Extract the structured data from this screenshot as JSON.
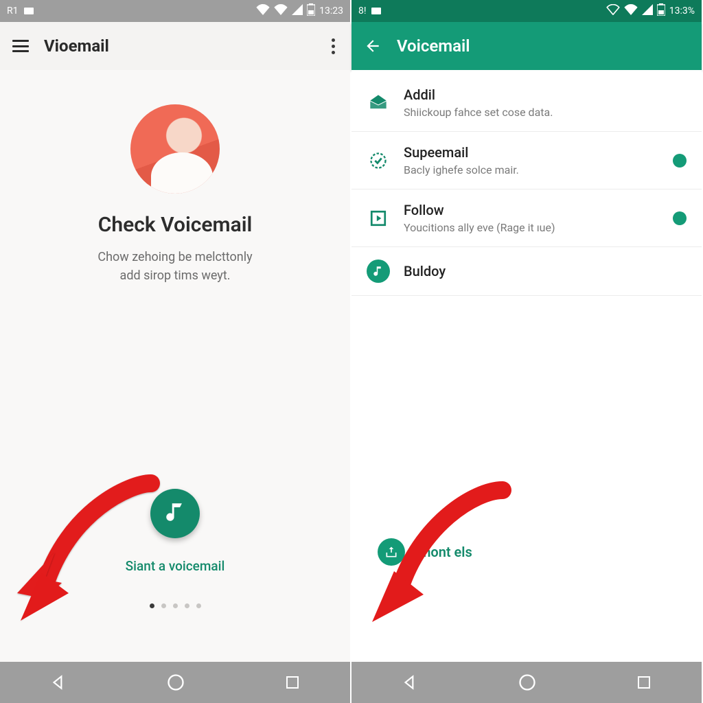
{
  "left": {
    "status": {
      "carrier": "R1",
      "time": "13:23"
    },
    "appbar": {
      "title": "Vioemail"
    },
    "hero": {
      "title": "Check Voicemail",
      "sub1": "Chow zehoing be melcttonly",
      "sub2": "add sirop tims weyt."
    },
    "fab_label": "Siant a voicemail"
  },
  "right": {
    "status": {
      "carrier": "8!",
      "time": "13:3%"
    },
    "appbar": {
      "title": "Voicemail"
    },
    "items": [
      {
        "title": "Addil",
        "sub": "Shiickoup fahce set cose data.",
        "indicator": false,
        "icon": "mail"
      },
      {
        "title": "Supeemail",
        "sub": "Bacly ighefe solce mair.",
        "indicator": true,
        "icon": "check"
      },
      {
        "title": "Follow",
        "sub": "Youcitions ally eve (Rage it ıue)",
        "indicator": true,
        "icon": "play"
      },
      {
        "title": "Buldoy",
        "sub": "",
        "indicator": false,
        "icon": "note"
      }
    ],
    "chip_label": "Shont  els"
  }
}
